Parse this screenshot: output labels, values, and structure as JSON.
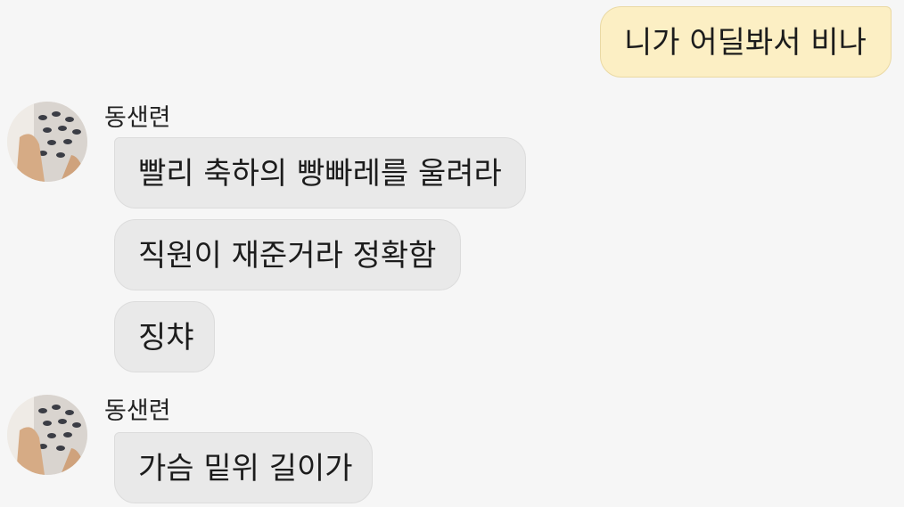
{
  "chat": {
    "outgoing": [
      {
        "text": "니가 어딜봐서 비나"
      }
    ],
    "groups": [
      {
        "sender": "동샌련",
        "avatar_icon": "profile-photo-icon",
        "messages": [
          "빨리 축하의 빵빠레를 울려라",
          "직원이 재준거라 정확함",
          "징챠"
        ]
      },
      {
        "sender": "동샌련",
        "avatar_icon": "profile-photo-icon",
        "messages": [
          "가슴 밑위 길이가"
        ]
      }
    ]
  },
  "colors": {
    "background": "#f6f6f6",
    "outgoing_bubble": "#fcefc4",
    "incoming_bubble": "#e9e9e9"
  }
}
